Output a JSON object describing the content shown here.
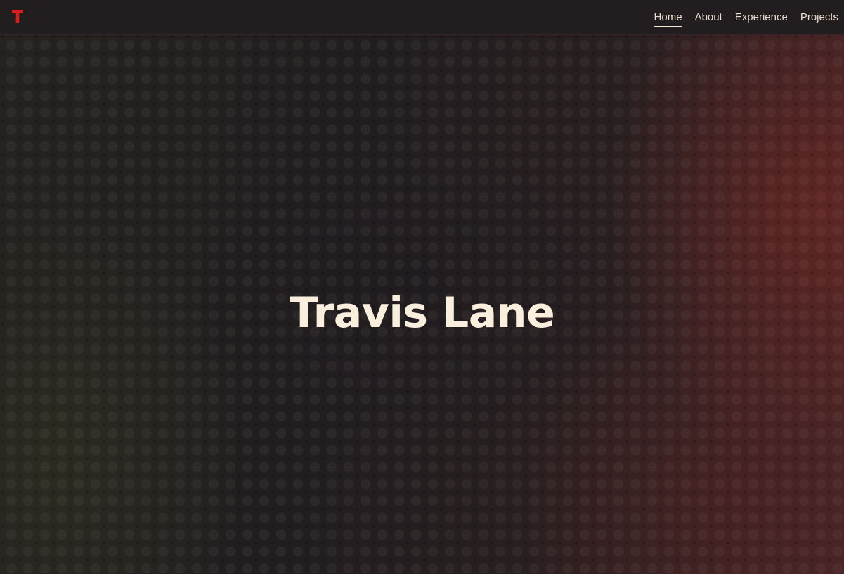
{
  "brand": {
    "logo_letter": "T",
    "logo_icon": "t-logo-icon",
    "accent_color": "#e01b1b"
  },
  "nav": {
    "items": [
      {
        "label": "Home",
        "active": true
      },
      {
        "label": "About",
        "active": false
      },
      {
        "label": "Experience",
        "active": false
      },
      {
        "label": "Projects",
        "active": false
      }
    ]
  },
  "hero": {
    "name": "Travis Lane"
  },
  "colors": {
    "background": "#221d1f",
    "text": "#faeedd"
  }
}
